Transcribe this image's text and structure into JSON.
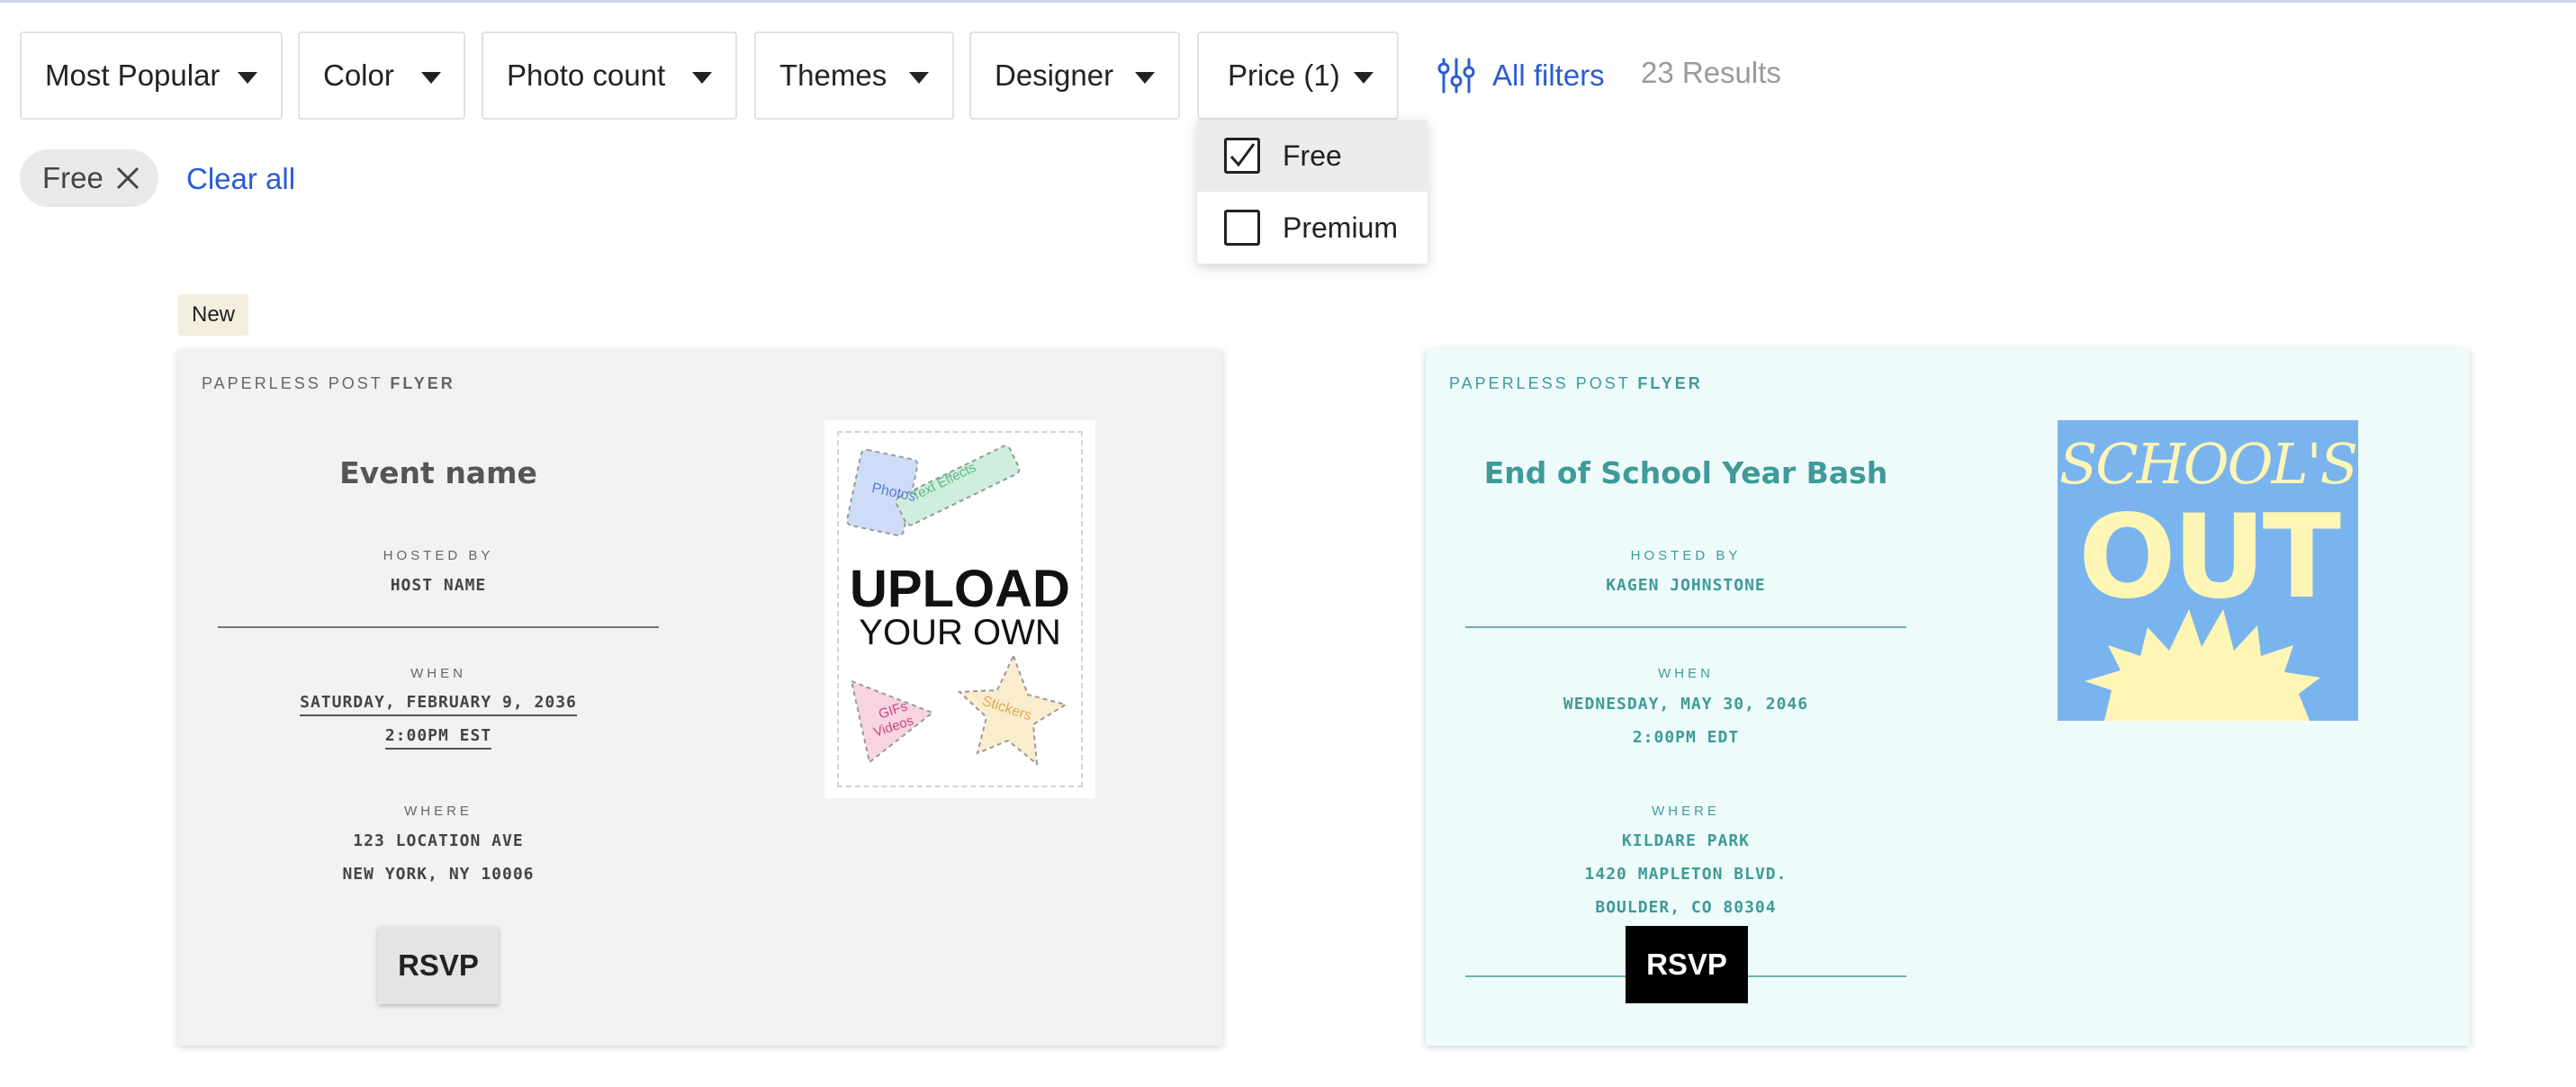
{
  "filters": {
    "buttons": [
      {
        "label": "Most Popular"
      },
      {
        "label": "Color"
      },
      {
        "label": "Photo count"
      },
      {
        "label": "Themes"
      },
      {
        "label": "Designer"
      },
      {
        "label": "Price (1)"
      }
    ],
    "all_filters_label": "All filters",
    "results_text": "23 Results",
    "price_dropdown": {
      "options": [
        {
          "label": "Free",
          "checked": true
        },
        {
          "label": "Premium",
          "checked": false
        }
      ]
    },
    "active_chips": [
      {
        "label": "Free"
      }
    ],
    "clear_all_label": "Clear all"
  },
  "cards": [
    {
      "badge": "New",
      "brand_prefix": "PAPERLESS POST",
      "brand_suffix": "FLYER",
      "title": "Event name",
      "hosted_by_label": "HOSTED BY",
      "host": "HOST NAME",
      "when_label": "WHEN",
      "date": "SATURDAY, FEBRUARY 9, 2036",
      "time": "2:00PM EST",
      "where_label": "WHERE",
      "address_lines": [
        "123 LOCATION AVE",
        "NEW YORK, NY 10006"
      ],
      "rsvp_label": "RSVP",
      "image": {
        "line1": "UPLOAD",
        "line2": "YOUR OWN",
        "stickers": [
          "Photos",
          "Text Effects",
          "GIFs",
          "Videos",
          "Stickers"
        ]
      }
    },
    {
      "brand_prefix": "PAPERLESS POST",
      "brand_suffix": "FLYER",
      "title": "End of School Year Bash",
      "hosted_by_label": "HOSTED BY",
      "host": "KAGEN JOHNSTONE",
      "when_label": "WHEN",
      "date": "WEDNESDAY, MAY 30, 2046",
      "time": "2:00PM EDT",
      "where_label": "WHERE",
      "address_lines": [
        "KILDARE PARK",
        "1420 MAPLETON BLVD.",
        "BOULDER, CO 80304"
      ],
      "rsvp_label": "RSVP",
      "image": {
        "line1": "SCHOOL'S",
        "line2": "OUT"
      }
    }
  ],
  "colors": {
    "link": "#2a5bd7",
    "card1_bg": "#f2f2f2",
    "card2_bg": "#edfcfb",
    "card2_accent": "#3f9a98",
    "school_sky": "#7ab4ef",
    "school_yellow": "#fdf6b4"
  }
}
